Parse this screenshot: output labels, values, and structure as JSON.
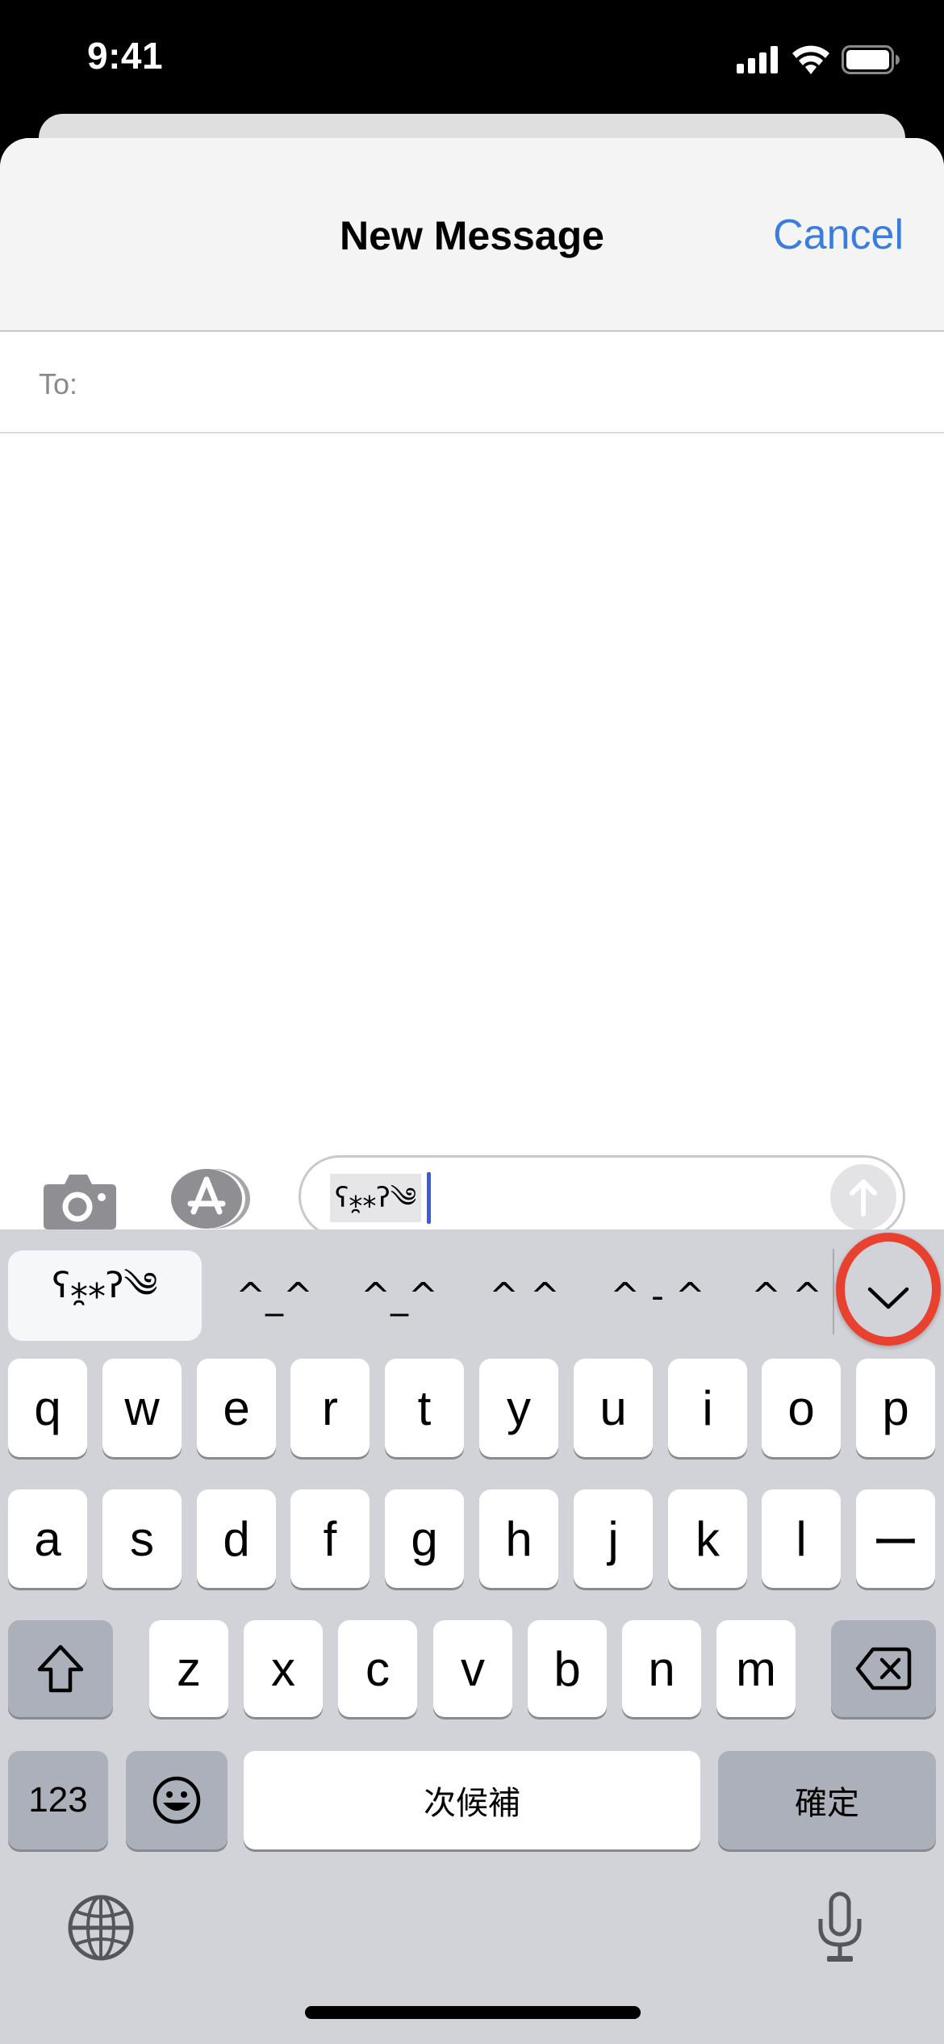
{
  "status_bar": {
    "time": "9:41",
    "icons": [
      "cellular-signal-icon",
      "wifi-icon",
      "battery-icon"
    ]
  },
  "nav": {
    "title": "New Message",
    "cancel_label": "Cancel",
    "accent_color": "#3b7ddc"
  },
  "recipient": {
    "label": "To:",
    "value": ""
  },
  "compose": {
    "camera_icon": "camera-icon",
    "apps_icon": "app-store-icon",
    "message_text": "ʕ⁎̯⁎ʔ༄",
    "send_icon": "arrow-up-icon"
  },
  "keyboard": {
    "candidates": [
      "ʕ⁎̯⁎ʔ༄",
      "^_^",
      "^_^",
      "^ ^",
      "^ - ^",
      "^ ^"
    ],
    "expand_icon": "chevron-down-icon",
    "annotation_color": "#e84130",
    "rows": [
      [
        "q",
        "w",
        "e",
        "r",
        "t",
        "y",
        "u",
        "i",
        "o",
        "p"
      ],
      [
        "a",
        "s",
        "d",
        "f",
        "g",
        "h",
        "j",
        "k",
        "l",
        "ー"
      ],
      [
        "z",
        "x",
        "c",
        "v",
        "b",
        "n",
        "m"
      ]
    ],
    "shift_icon": "shift-icon",
    "delete_icon": "delete-backspace-icon",
    "numbers_label": "123",
    "emoji_icon": "emoji-face-icon",
    "space_label": "次候補",
    "confirm_label": "確定",
    "globe_icon": "globe-icon",
    "mic_icon": "microphone-icon"
  }
}
